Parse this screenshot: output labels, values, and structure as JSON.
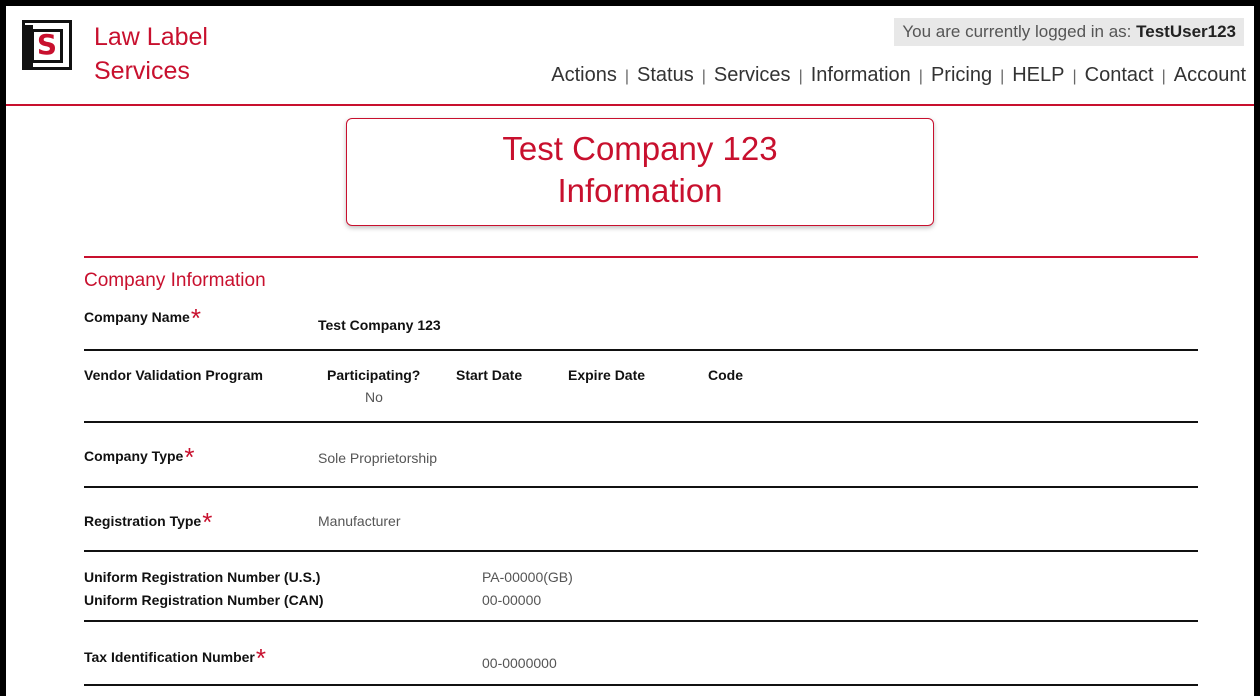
{
  "header": {
    "brand_line1": "Law Label",
    "brand_line2": "Services",
    "logo_letter": "S",
    "login_prefix": "You are currently logged in as:",
    "login_user": "TestUser123",
    "nav": [
      "Actions",
      "Status",
      "Services",
      "Information",
      "Pricing",
      "HELP",
      "Contact",
      "Account"
    ],
    "nav_separator": "|"
  },
  "title": {
    "line1": "Test Company 123",
    "line2": "Information"
  },
  "section": {
    "heading": "Company Information",
    "required_mark": "*",
    "company_name_label": "Company Name",
    "company_name_value": "Test Company 123",
    "vendor_label": "Vendor Validation Program",
    "vendor_columns": [
      "Participating?",
      "Start Date",
      "Expire Date",
      "Code"
    ],
    "vendor_participating_value": "No",
    "company_type_label": "Company Type",
    "company_type_value": "Sole Proprietorship",
    "registration_type_label": "Registration Type",
    "registration_type_value": "Manufacturer",
    "urn_us_label": "Uniform Registration Number (U.S.)",
    "urn_us_value": "PA-00000(GB)",
    "urn_can_label": "Uniform Registration Number (CAN)",
    "urn_can_value": "00-00000",
    "tax_id_label": "Tax Identification Number",
    "tax_id_value": "00-0000000"
  },
  "colors": {
    "accent": "#c8102e",
    "text": "#222222",
    "muted": "#555555"
  }
}
